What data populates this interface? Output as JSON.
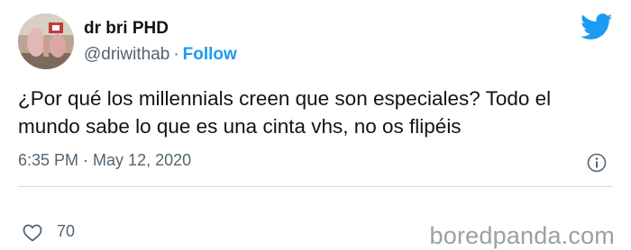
{
  "tweet": {
    "author_name": "dr bri PHD",
    "handle": "@driwithab",
    "separator": "·",
    "follow_label": "Follow",
    "text": "¿Por qué los millennials creen que son especiales? Todo el mundo sabe lo que es una cinta vhs, no os flipéis",
    "time": "6:35 PM",
    "date_separator": "·",
    "date": "May 12, 2020",
    "like_count": "70"
  },
  "watermark": "boredpanda.com",
  "icons": {
    "brand": "twitter-bird-icon",
    "info": "info-icon",
    "like": "heart-icon"
  },
  "colors": {
    "accent": "#1d9bf0",
    "text": "#0f1419",
    "secondary": "#536471",
    "divider": "#cfd9de",
    "watermark": "#9aa0a6"
  }
}
